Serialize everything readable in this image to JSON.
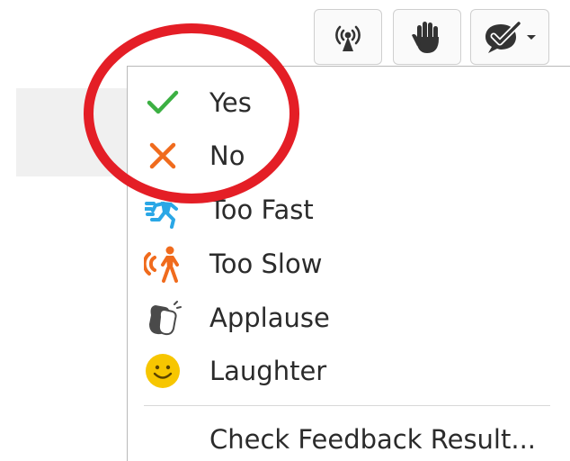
{
  "toolbar": {
    "buttons": [
      {
        "name": "broadcast",
        "icon": "broadcast-icon"
      },
      {
        "name": "raise-hand",
        "icon": "raised-hand-icon"
      },
      {
        "name": "feedback",
        "icon": "feedback-check-bubble-icon",
        "has_dropdown": true
      }
    ]
  },
  "menu": {
    "items": [
      {
        "label": "Yes",
        "icon": "check-icon",
        "icon_color": "#3cb043"
      },
      {
        "label": "No",
        "icon": "cross-icon",
        "icon_color": "#f06b1d"
      },
      {
        "label": "Too Fast",
        "icon": "running-person-icon",
        "icon_color": "#2aa7e6"
      },
      {
        "label": "Too Slow",
        "icon": "walking-person-icon",
        "icon_color": "#f06b1d"
      },
      {
        "label": "Applause",
        "icon": "clapping-hands-icon",
        "icon_color": "#4a4a4a"
      },
      {
        "label": "Laughter",
        "icon": "smiley-face-icon",
        "icon_color": "#f7c600"
      }
    ],
    "footer_label": "Check Feedback Result..."
  },
  "annotation": {
    "shape": "circle",
    "color": "#e41e26",
    "highlights": [
      "Yes",
      "No"
    ]
  }
}
